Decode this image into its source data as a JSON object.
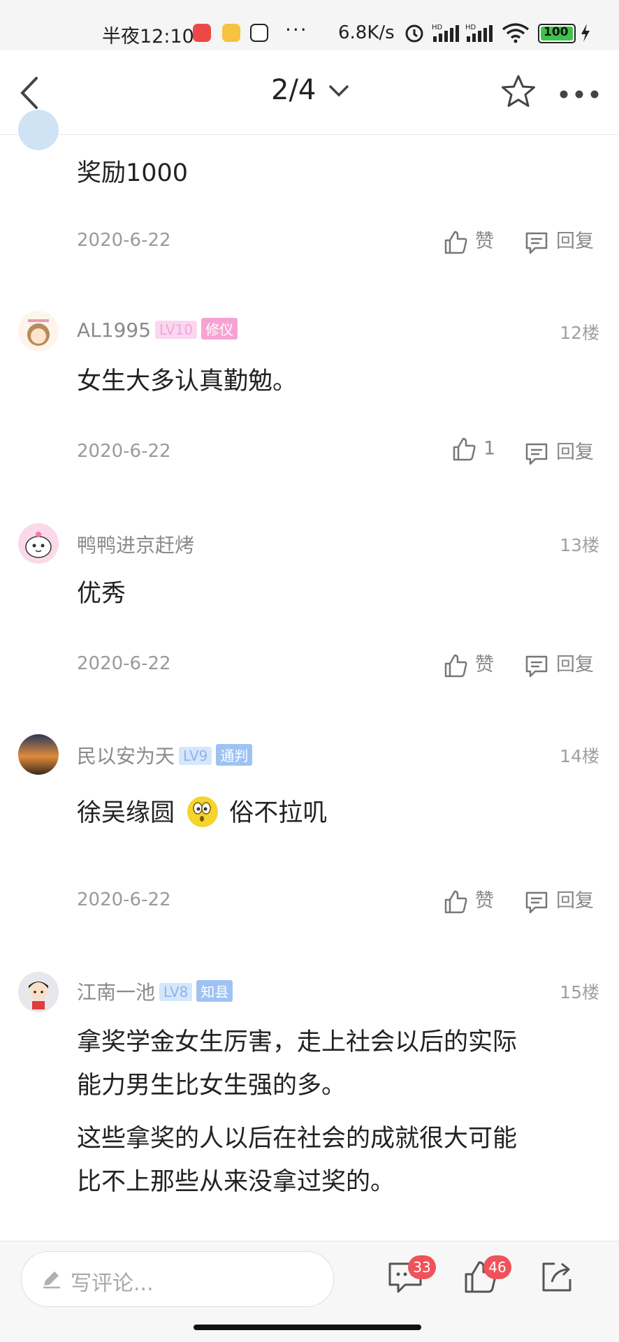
{
  "status_bar": {
    "time": "半夜12:10",
    "more": "···",
    "net_speed": "6.8K/s",
    "battery": "100"
  },
  "header": {
    "page_indicator": "2/4"
  },
  "comments": [
    {
      "text_lines": [
        "奖励1000"
      ],
      "date": "2020-6-22",
      "like_label": "赞",
      "reply_label": "回复"
    },
    {
      "username": "AL1995",
      "level": "LV10",
      "title": "修仪",
      "floor": "12楼",
      "text_lines": [
        "女生大多认真勤勉。"
      ],
      "date": "2020-6-22",
      "like_label": "1",
      "reply_label": "回复"
    },
    {
      "username": "鸭鸭进京赶烤",
      "floor": "13楼",
      "text_lines": [
        "优秀"
      ],
      "date": "2020-6-22",
      "like_label": "赞",
      "reply_label": "回复"
    },
    {
      "username": "民以安为天",
      "level": "LV9",
      "title": "通判",
      "floor": "14楼",
      "text_before_emoji": "徐吴缘圆",
      "text_after_emoji": "俗不拉叽",
      "date": "2020-6-22",
      "like_label": "赞",
      "reply_label": "回复"
    },
    {
      "username": "江南一池",
      "level": "LV8",
      "title": "知县",
      "floor": "15楼",
      "text_lines": [
        "拿奖学金女生厉害，走上社会以后的实际",
        "能力男生比女生强的多。",
        "这些拿奖的人以后在社会的成就很大可能",
        "比不上那些从来没拿过奖的。"
      ]
    }
  ],
  "bottom_bar": {
    "input_placeholder": "写评论...",
    "comment_count": "33",
    "like_count": "46"
  },
  "colors": {
    "pink_tag": "#f6a3d3",
    "blue_tag": "#9ec3f2",
    "badge_red": "#f0525a"
  }
}
